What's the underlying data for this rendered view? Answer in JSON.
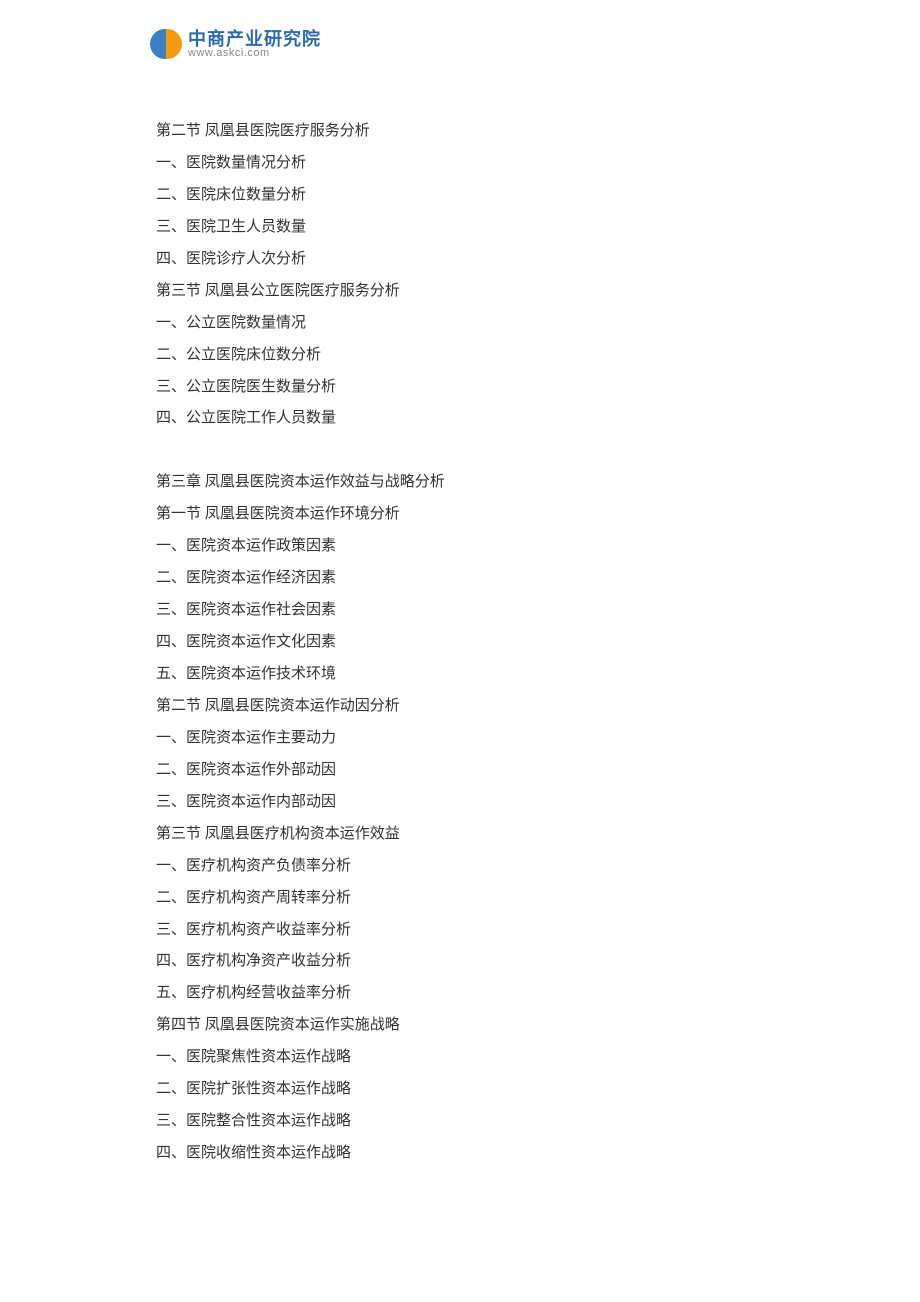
{
  "logo": {
    "cn": "中商产业研究院",
    "en": "www.askci.com"
  },
  "toc": [
    "第二节 凤凰县医院医疗服务分析",
    "一、医院数量情况分析",
    "二、医院床位数量分析",
    "三、医院卫生人员数量",
    "四、医院诊疗人次分析",
    "第三节 凤凰县公立医院医疗服务分析",
    "一、公立医院数量情况",
    "二、公立医院床位数分析",
    "三、公立医院医生数量分析",
    "四、公立医院工作人员数量",
    "",
    "第三章 凤凰县医院资本运作效益与战略分析",
    "第一节 凤凰县医院资本运作环境分析",
    "一、医院资本运作政策因素",
    "二、医院资本运作经济因素",
    "三、医院资本运作社会因素",
    "四、医院资本运作文化因素",
    "五、医院资本运作技术环境",
    "第二节 凤凰县医院资本运作动因分析",
    "一、医院资本运作主要动力",
    "二、医院资本运作外部动因",
    "三、医院资本运作内部动因",
    "第三节 凤凰县医疗机构资本运作效益",
    "一、医疗机构资产负债率分析",
    "二、医疗机构资产周转率分析",
    "三、医疗机构资产收益率分析",
    "四、医疗机构净资产收益分析",
    "五、医疗机构经营收益率分析",
    "第四节 凤凰县医院资本运作实施战略",
    "一、医院聚焦性资本运作战略",
    "二、医院扩张性资本运作战略",
    "三、医院整合性资本运作战略",
    "四、医院收缩性资本运作战略"
  ]
}
